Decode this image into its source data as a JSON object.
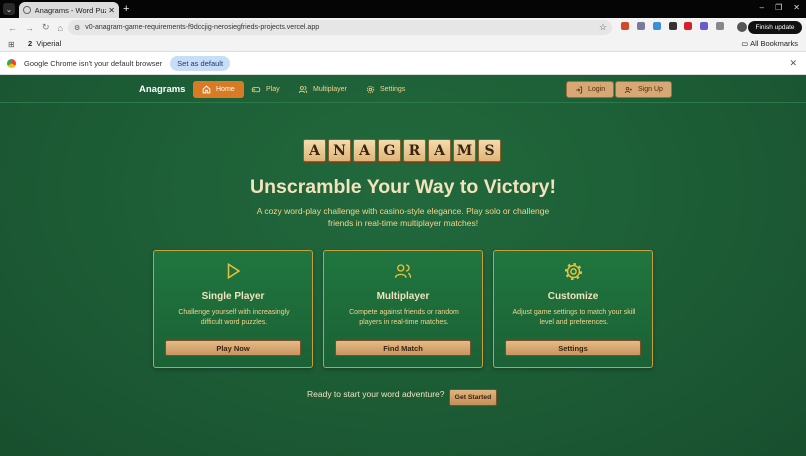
{
  "browser": {
    "tab_title": "Anagrams - Word Puzzle",
    "new_tab": "+",
    "url": "v0-anagram-game-requirements-f9dccjig-nerosiegfrieds-projects.vercel.app",
    "finish_update": "Finish update",
    "bookmark_item": "Viperial",
    "bookmark_prefix": "2",
    "all_bookmarks": "All Bookmarks",
    "infobar_message": "Google Chrome isn't your default browser",
    "set_default": "Set as default"
  },
  "nav": {
    "brand": "Anagrams",
    "items": [
      {
        "label": "Home",
        "icon": "home-icon"
      },
      {
        "label": "Play",
        "icon": "gamepad-icon"
      },
      {
        "label": "Multiplayer",
        "icon": "users-icon"
      },
      {
        "label": "Settings",
        "icon": "gear-icon"
      }
    ],
    "login": "Login",
    "signup": "Sign Up"
  },
  "hero": {
    "tiles": [
      "A",
      "N",
      "A",
      "G",
      "R",
      "A",
      "M",
      "S"
    ],
    "headline": "Unscramble Your Way to Victory!",
    "subtitle": "A cozy word-play challenge with casino-style elegance. Play solo or challenge friends in real-time multiplayer matches!"
  },
  "cards": [
    {
      "title": "Single Player",
      "desc": "Challenge yourself with increasingly difficult word puzzles.",
      "button": "Play Now",
      "icon": "play-icon"
    },
    {
      "title": "Multiplayer",
      "desc": "Compete against friends or random players in real-time matches.",
      "button": "Find Match",
      "icon": "users-icon"
    },
    {
      "title": "Customize",
      "desc": "Adjust game settings to match your skill level and preferences.",
      "button": "Settings",
      "icon": "gear-icon"
    }
  ],
  "cta": {
    "text": "Ready to start your word adventure?",
    "button": "Get Started"
  },
  "colors": {
    "background": "#1b5a33",
    "accent": "#d97b25",
    "gold": "#c4a03f",
    "cream": "#f2e3bd"
  }
}
